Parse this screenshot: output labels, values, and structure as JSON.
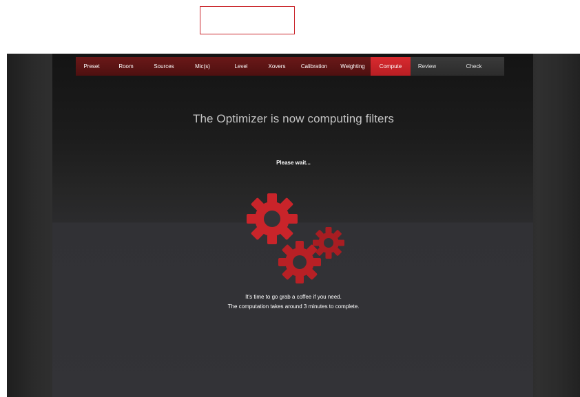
{
  "colors": {
    "accent": "#d82a2f",
    "nav_done": "#5a1414",
    "nav_future": "#333333",
    "gear": "#c9242a"
  },
  "nav": {
    "steps": [
      {
        "label": "Preset",
        "state": "done"
      },
      {
        "label": "Room",
        "state": "done"
      },
      {
        "label": "Sources",
        "state": "done"
      },
      {
        "label": "Mic(s)",
        "state": "done"
      },
      {
        "label": "Level",
        "state": "done"
      },
      {
        "label": "Xovers",
        "state": "done"
      },
      {
        "label": "Calibration",
        "state": "done"
      },
      {
        "label": "Weighting",
        "state": "done"
      },
      {
        "label": "Compute",
        "state": "active"
      },
      {
        "label": "Review",
        "state": "future"
      },
      {
        "label": "Check",
        "state": "future"
      }
    ]
  },
  "main": {
    "headline": "The Optimizer is now computing filters",
    "wait": "Please wait...",
    "icon": "gears-icon",
    "footer_line1": "It's time to go grab a coffee if you need.",
    "footer_line2": "The computation takes around 3 minutes to complete."
  }
}
